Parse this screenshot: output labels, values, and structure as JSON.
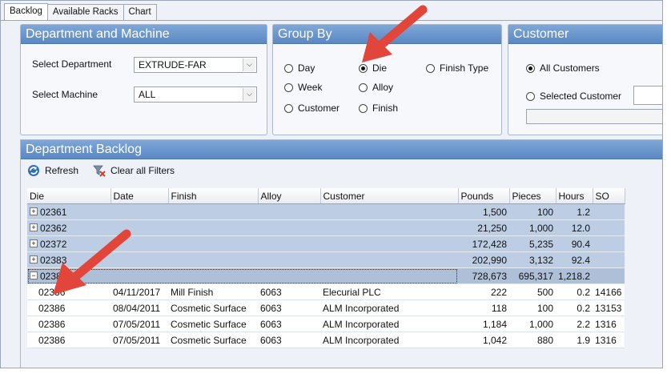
{
  "tabs": [
    "Backlog",
    "Available Racks",
    "Chart"
  ],
  "department_machine": {
    "title": "Department and Machine",
    "department_label": "Select Department",
    "department_value": "EXTRUDE-FAR",
    "machine_label": "Select Machine",
    "machine_value": "ALL"
  },
  "group_by": {
    "title": "Group By",
    "options": [
      "Day",
      "Die",
      "Finish Type",
      "Week",
      "Alloy",
      "Customer",
      "Finish"
    ],
    "selected": "Die"
  },
  "customer": {
    "title": "Customer",
    "all_label": "All Customers",
    "selected_label": "Selected Customer",
    "selected": "All Customers"
  },
  "backlog": {
    "title": "Department Backlog",
    "refresh_label": "Refresh",
    "clear_filters_label": "Clear all Filters",
    "columns": [
      "Die",
      "Date",
      "Finish",
      "Alloy",
      "Customer",
      "Pounds",
      "Pieces",
      "Hours",
      "SO"
    ],
    "group_rows": [
      {
        "die": "02361",
        "pounds": "1,500",
        "pieces": "100",
        "hours": "1.2"
      },
      {
        "die": "02362",
        "pounds": "21,250",
        "pieces": "1,000",
        "hours": "12.0"
      },
      {
        "die": "02372",
        "pounds": "172,428",
        "pieces": "5,235",
        "hours": "90.4"
      },
      {
        "die": "02383",
        "pounds": "202,990",
        "pieces": "3,132",
        "hours": "92.4"
      },
      {
        "die": "02386",
        "pounds": "728,673",
        "pieces": "695,317",
        "hours": "1,218.2"
      }
    ],
    "detail_rows": [
      {
        "die": "02386",
        "date": "04/11/2017",
        "finish": "Mill Finish",
        "alloy": "6063",
        "customer": "Elecurial PLC",
        "pounds": "222",
        "pieces": "500",
        "hours": "0.2",
        "so": "14166"
      },
      {
        "die": "02386",
        "date": "08/04/2011",
        "finish": "Cosmetic Surface",
        "alloy": "6063",
        "customer": "ALM Incorporated",
        "pounds": "118",
        "pieces": "100",
        "hours": "0.2",
        "so": "13153"
      },
      {
        "die": "02386",
        "date": "07/05/2011",
        "finish": "Cosmetic Surface",
        "alloy": "6063",
        "customer": "ALM Incorporated",
        "pounds": "1,184",
        "pieces": "1,000",
        "hours": "2.2",
        "so": "1316"
      },
      {
        "die": "02386",
        "date": "07/05/2011",
        "finish": "Cosmetic Surface",
        "alloy": "6063",
        "customer": "ALM Incorporated",
        "pounds": "1,042",
        "pieces": "880",
        "hours": "1.9",
        "so": "1316"
      }
    ]
  },
  "colors": {
    "header_blue": "#5b88c4",
    "group_row": "#bccde4",
    "arrow": "#e2453a"
  }
}
